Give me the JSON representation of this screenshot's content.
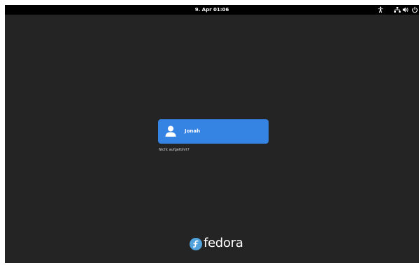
{
  "topbar": {
    "datetime": "9. Apr  01:06",
    "icons": [
      "accessibility-icon",
      "network-icon",
      "volume-icon",
      "power-icon"
    ]
  },
  "login": {
    "users": [
      {
        "name": "Jonah"
      }
    ],
    "not_listed_label": "Nicht aufgeführt?"
  },
  "branding": {
    "name": "fedora"
  },
  "colors": {
    "background": "#242424",
    "topbar": "#000000",
    "accent": "#3584e4",
    "fedora_blue": "#51a2da"
  }
}
